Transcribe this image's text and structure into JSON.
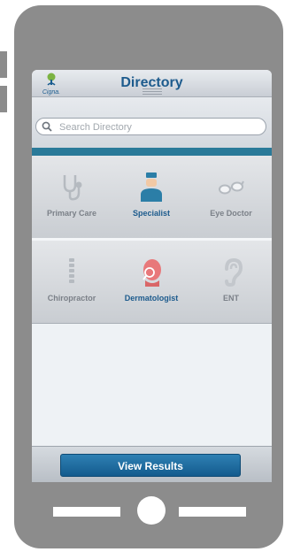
{
  "header": {
    "logo_text": "Cigna.",
    "title": "Directory"
  },
  "search": {
    "placeholder": "Search Directory",
    "value": ""
  },
  "categories": [
    {
      "label": "Primary Care",
      "icon": "stethoscope-icon",
      "selected": false
    },
    {
      "label": "Specialist",
      "icon": "specialist-doctor-icon",
      "selected": true
    },
    {
      "label": "Eye Doctor",
      "icon": "eyeglasses-icon",
      "selected": false
    },
    {
      "label": "Chiropractor",
      "icon": "spine-icon",
      "selected": false
    },
    {
      "label": "Dermatologist",
      "icon": "dermatology-face-icon",
      "selected": true
    },
    {
      "label": "ENT",
      "icon": "ear-icon",
      "selected": false
    }
  ],
  "footer": {
    "view_results_label": "View Results"
  },
  "colors": {
    "phone_body": "#8c8c8c",
    "accent_blue": "#1d5b8d",
    "teal_bar": "#2a7a99",
    "button_blue": "#1f6ea3",
    "inactive_label": "#7b8088"
  }
}
